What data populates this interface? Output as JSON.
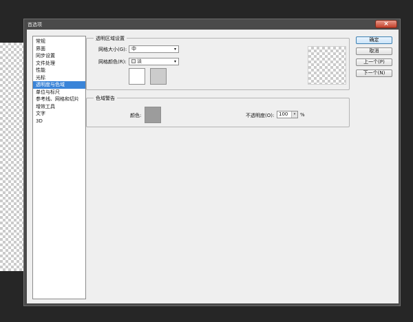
{
  "dialog": {
    "title": "首选项",
    "close_glyph": "×"
  },
  "categories": [
    {
      "label": "常规",
      "selected": false
    },
    {
      "label": "界面",
      "selected": false
    },
    {
      "label": "同步设置",
      "selected": false
    },
    {
      "label": "文件处理",
      "selected": false
    },
    {
      "label": "性能",
      "selected": false
    },
    {
      "label": "光标",
      "selected": false
    },
    {
      "label": "透明度与色域",
      "selected": true
    },
    {
      "label": "单位与标尺",
      "selected": false
    },
    {
      "label": "参考线、网格和切片",
      "selected": false
    },
    {
      "label": "增效工具",
      "selected": false
    },
    {
      "label": "文字",
      "selected": false
    },
    {
      "label": "3D",
      "selected": false
    }
  ],
  "transparency": {
    "legend": "透明区域设置",
    "grid_size_label": "网格大小(G):",
    "grid_size_value": "中",
    "grid_colors_label": "网格颜色(R):",
    "grid_colors_value": "淡",
    "swatch_light": "#ffffff",
    "swatch_dark": "#cccccc"
  },
  "gamut": {
    "legend": "色域警告",
    "color_label": "颜色:",
    "color_value": "#9c9c9c",
    "opacity_label": "不透明度(O):",
    "opacity_value": "100",
    "opacity_unit": "%"
  },
  "buttons": {
    "ok": "确定",
    "cancel": "取消",
    "prev": "上一个(P)",
    "next": "下一个(N)"
  },
  "icons": {
    "dropdown": "▾",
    "close": "close-icon"
  }
}
